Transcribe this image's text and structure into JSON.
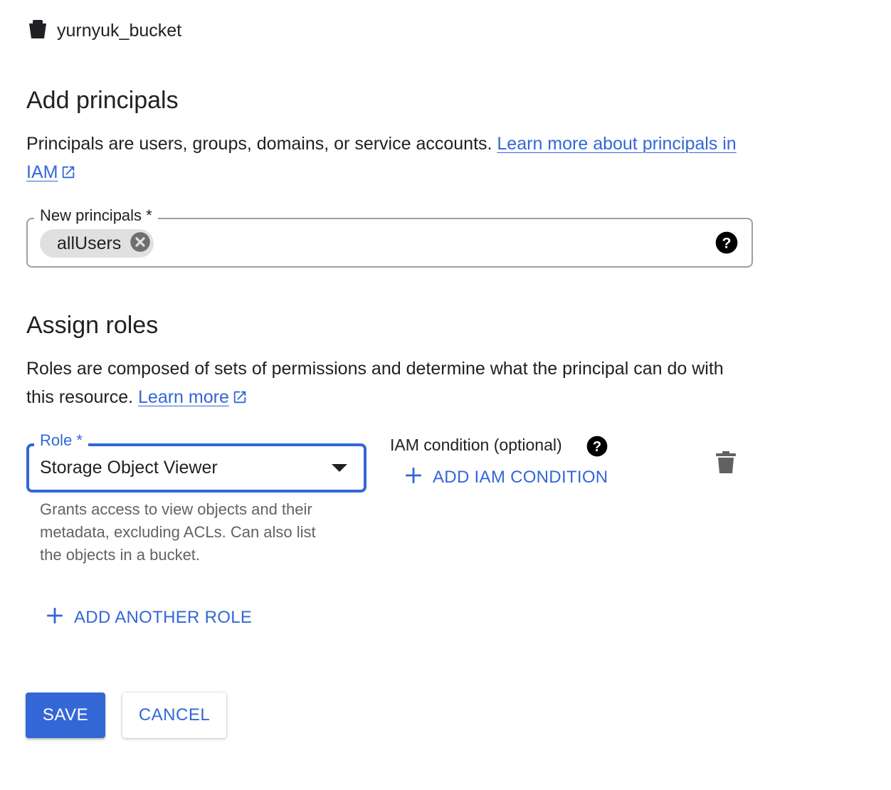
{
  "header": {
    "bucket_name": "yurnyuk_bucket",
    "icon": "bucket-icon"
  },
  "principals": {
    "title": "Add principals",
    "description": "Principals are users, groups, domains, or service accounts. ",
    "learn_link": "Learn more about principals in IAM",
    "field_label": "New principals *",
    "chips": [
      "allUsers"
    ]
  },
  "roles": {
    "title": "Assign roles",
    "description": "Roles are composed of sets of permissions and determine what the principal can do with this resource. ",
    "learn_link": "Learn more",
    "role_label": "Role *",
    "role_value": "Storage Object Viewer",
    "role_description": "Grants access to view objects and their metadata, excluding ACLs. Can also list the objects in a bucket.",
    "condition_label": "IAM condition (optional)",
    "add_condition": "ADD IAM CONDITION",
    "add_role": "ADD ANOTHER ROLE"
  },
  "actions": {
    "save": "SAVE",
    "cancel": "CANCEL"
  },
  "colors": {
    "accent": "#3367d6",
    "chip_bg": "#e0e0e0",
    "secondary_text": "#5f6368"
  }
}
